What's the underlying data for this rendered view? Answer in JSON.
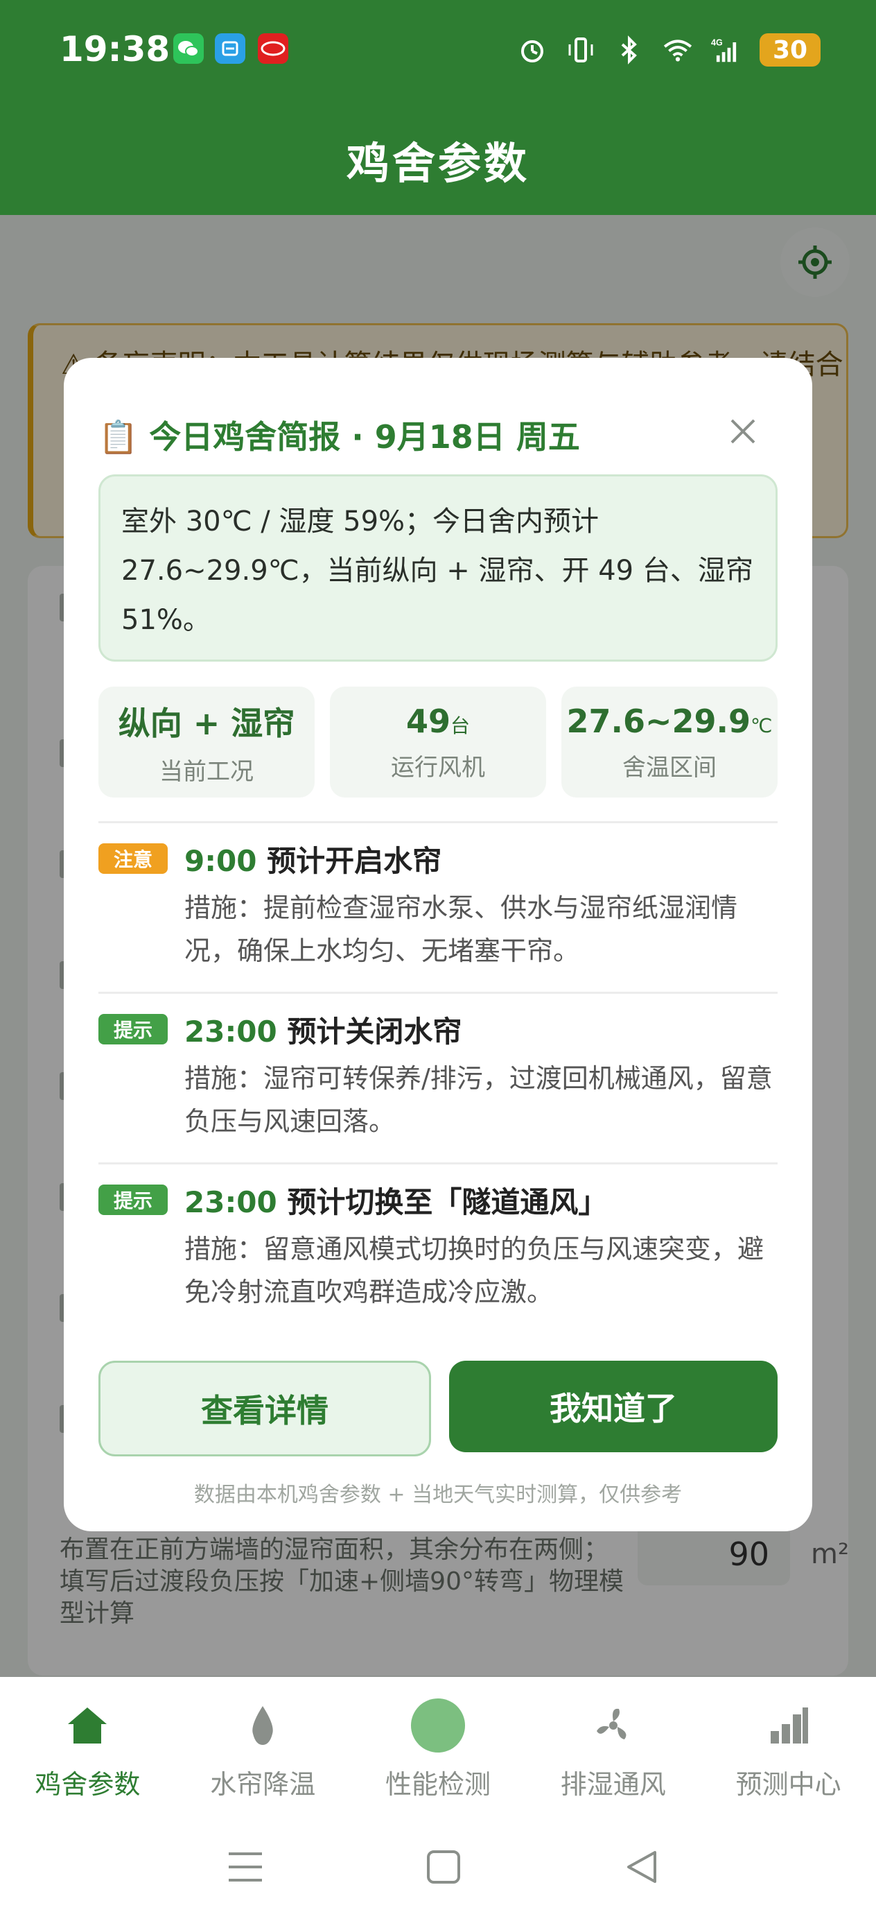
{
  "status_bar": {
    "time": "19:38",
    "battery": "30",
    "icons": [
      "wechat-icon",
      "app-icon",
      "byd-icon",
      "alarm-icon",
      "vibrate-icon",
      "bluetooth-icon",
      "wifi-icon",
      "signal-4g-icon",
      "battery-icon"
    ]
  },
  "header": {
    "title": "鸡舍参数"
  },
  "background": {
    "warning_text": "⚠ 备忘声明：本工具计算结果仅供现场测算与辅助参考，请结合",
    "param_desc": "布置在正前方端墙的湿帘面积，其余分布在两侧；填写后过渡段负压按「加速+侧墙90°转弯」物理模型计算",
    "param_value": "90",
    "param_unit": "m²"
  },
  "modal": {
    "title": "📋 今日鸡舍简报 · 9月18日 周五",
    "summary": "室外 30℃ / 湿度 59%；今日舍内预计 27.6~29.9℃，当前纵向 + 湿帘、开 49 台、湿帘 51%。",
    "stats": [
      {
        "value": "纵向 + 湿帘",
        "unit": "",
        "label": "当前工况"
      },
      {
        "value": "49",
        "unit": "台",
        "label": "运行风机"
      },
      {
        "value": "27.6~29.9",
        "unit": "℃",
        "label": "舍温区间"
      }
    ],
    "events": [
      {
        "badge": "注意",
        "time": "9:00",
        "title": "预计开启水帘",
        "measure": "措施：提前检查湿帘水泵、供水与湿帘纸湿润情况，确保上水均匀、无堵塞干帘。"
      },
      {
        "badge": "提示",
        "time": "23:00",
        "title": "预计关闭水帘",
        "measure": "措施：湿帘可转保养/排污，过渡回机械通风，留意负压与风速回落。"
      },
      {
        "badge": "提示",
        "time": "23:00",
        "title": "预计切换至「隧道通风」",
        "measure": "措施：留意通风模式切换时的负压与风速突变，避免冷射流直吹鸡群造成冷应激。"
      }
    ],
    "detail_button": "查看详情",
    "ok_button": "我知道了",
    "footnote": "数据由本机鸡舍参数 + 当地天气实时测算，仅供参考"
  },
  "bottom_nav": {
    "items": [
      {
        "label": "鸡舍参数",
        "icon": "house-icon",
        "active": true
      },
      {
        "label": "水帘降温",
        "icon": "water-drop-icon",
        "active": false
      },
      {
        "label": "性能检测",
        "icon": "circle-icon",
        "active": false
      },
      {
        "label": "排湿通风",
        "icon": "fan-icon",
        "active": false
      },
      {
        "label": "预测中心",
        "icon": "bar-chart-icon",
        "active": false
      }
    ]
  },
  "colors": {
    "primary": "#2e7d32",
    "warning": "#f0a020",
    "tip": "#43a047"
  }
}
